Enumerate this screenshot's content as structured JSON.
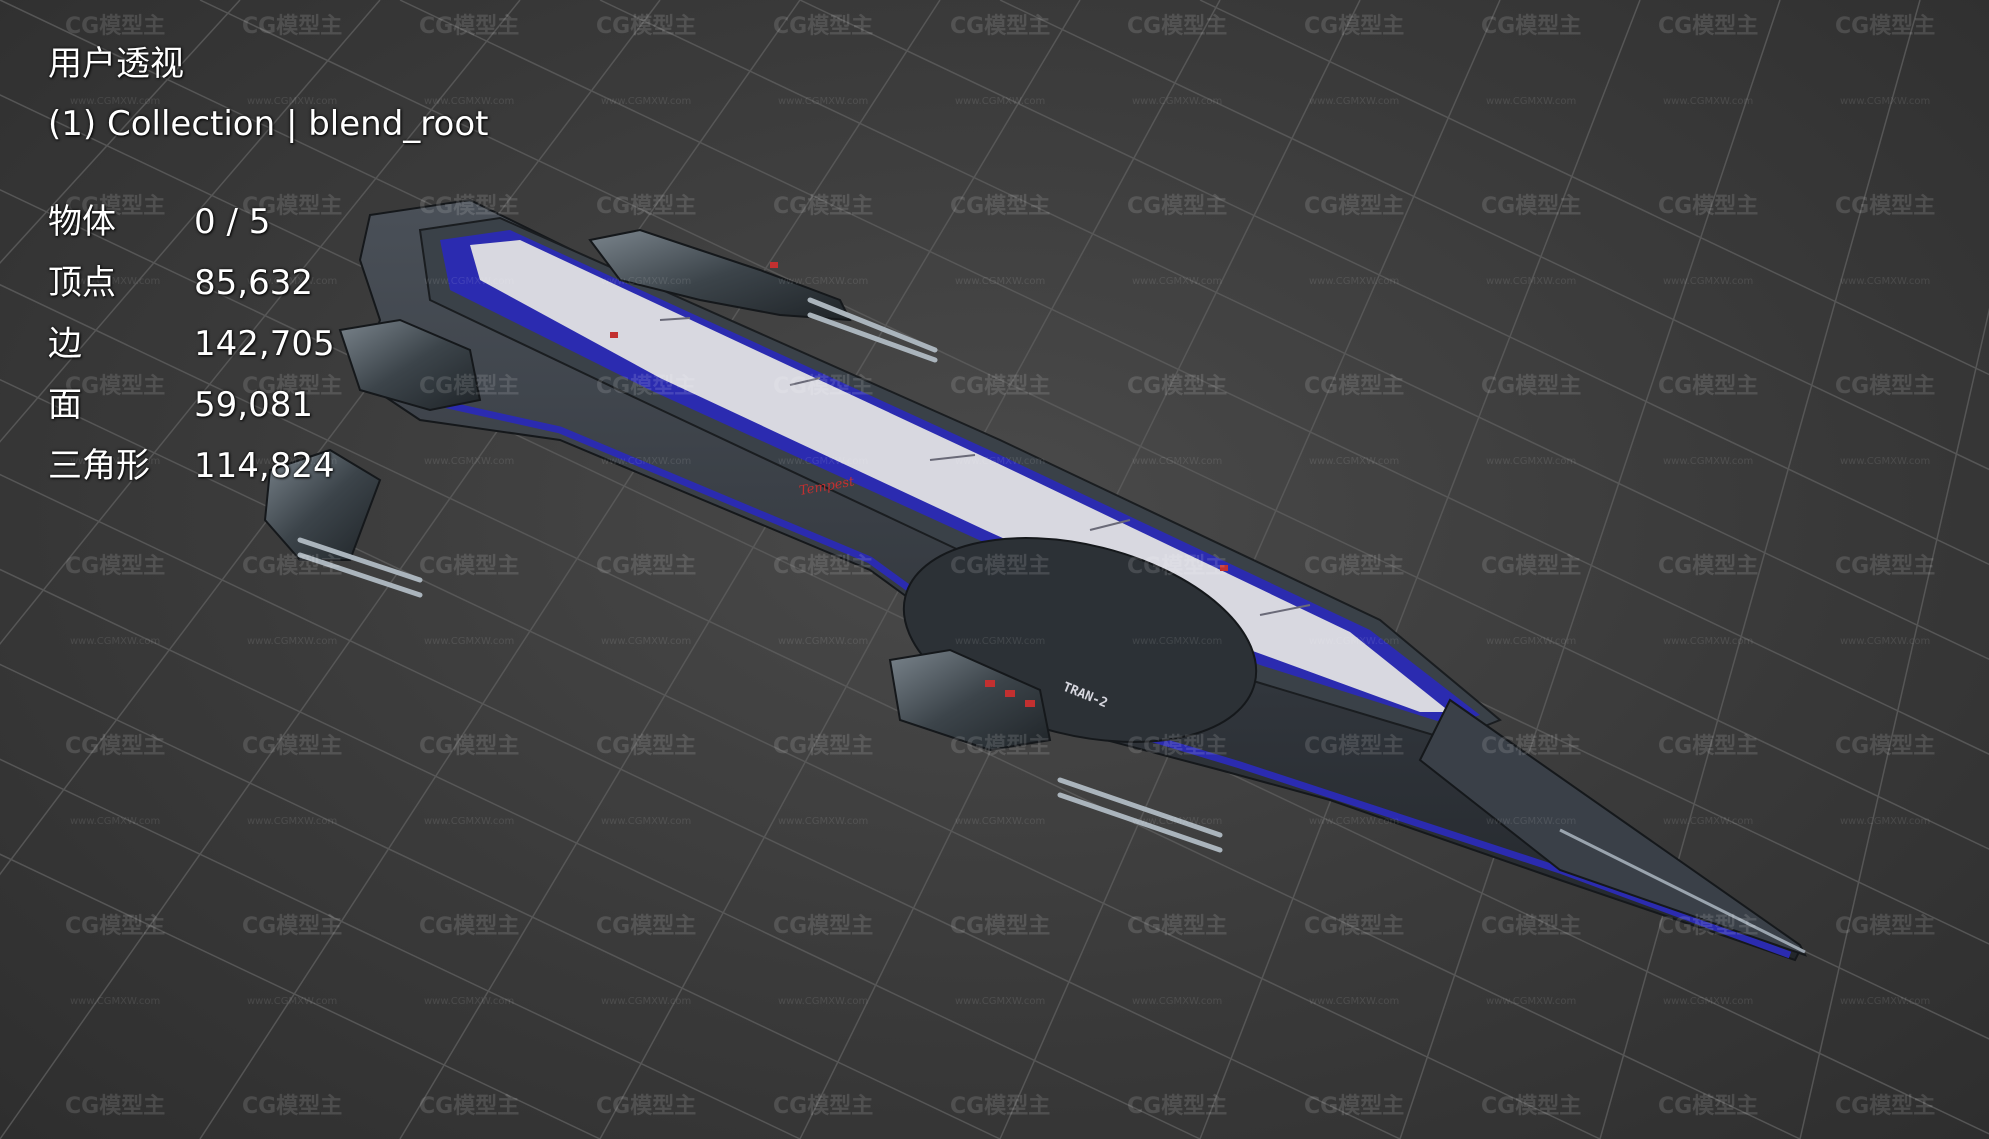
{
  "viewport": {
    "view_name": "用户透视",
    "collection": "(1) Collection | blend_root",
    "stats": [
      {
        "label": "物体",
        "value": "0 / 5"
      },
      {
        "label": "顶点",
        "value": "85,632"
      },
      {
        "label": "边",
        "value": "142,705"
      },
      {
        "label": "面",
        "value": "59,081"
      },
      {
        "label": "三角形",
        "value": "114,824"
      }
    ]
  },
  "model": {
    "hull_marking_1": "TRAN-2",
    "hull_marking_2": "Tempest"
  },
  "watermark": {
    "text": "CG模型主",
    "sub_text": "www.CGMXW.com"
  },
  "colors": {
    "background": "#3d3d3d",
    "grid_line": "#5a5a5a",
    "hull_dark": "#2e3338",
    "hull_stripe_blue": "#2b2bb0",
    "hull_stripe_white": "#d8d8e0",
    "accent_red": "#c23030"
  }
}
